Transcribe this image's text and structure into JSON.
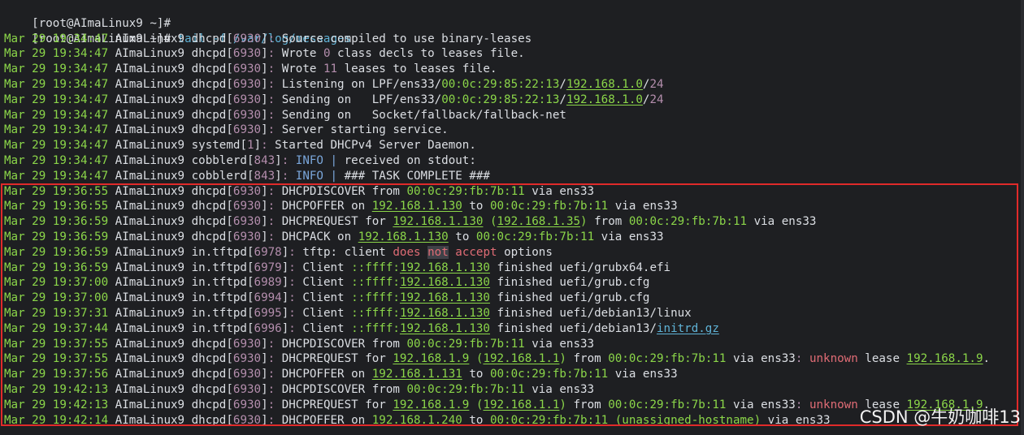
{
  "terminal": {
    "prompt1": "[root@AImaLinux9 ~]#",
    "prompt2": "[root@AImaLinux9 ~]#",
    "command": " tail -f /var/log/messages"
  },
  "log": [
    {
      "ts": "Mar 29 19:34:47",
      "host": "AImaLinux9",
      "proc": "dhcpd",
      "pid": "6930",
      "segs": [
        {
          "t": "Source compiled to use binary-leases",
          "c": "white"
        }
      ]
    },
    {
      "ts": "Mar 29 19:34:47",
      "host": "AImaLinux9",
      "proc": "dhcpd",
      "pid": "6930",
      "segs": [
        {
          "t": "Wrote ",
          "c": "white"
        },
        {
          "t": "0",
          "c": "violet"
        },
        {
          "t": " class decls to leases file.",
          "c": "white"
        }
      ]
    },
    {
      "ts": "Mar 29 19:34:47",
      "host": "AImaLinux9",
      "proc": "dhcpd",
      "pid": "6930",
      "segs": [
        {
          "t": "Wrote ",
          "c": "white"
        },
        {
          "t": "11",
          "c": "violet"
        },
        {
          "t": " leases to leases file.",
          "c": "white"
        }
      ]
    },
    {
      "ts": "Mar 29 19:34:47",
      "host": "AImaLinux9",
      "proc": "dhcpd",
      "pid": "6930",
      "segs": [
        {
          "t": "Listening on LPF/ens33/",
          "c": "white"
        },
        {
          "t": "00:0c:29:85:22:13",
          "c": "green"
        },
        {
          "t": "/",
          "c": "white"
        },
        {
          "t": "192.168.1.0",
          "c": "green",
          "u": true
        },
        {
          "t": "/",
          "c": "white"
        },
        {
          "t": "24",
          "c": "violet"
        }
      ]
    },
    {
      "ts": "Mar 29 19:34:47",
      "host": "AImaLinux9",
      "proc": "dhcpd",
      "pid": "6930",
      "segs": [
        {
          "t": "Sending on   LPF/ens33/",
          "c": "white"
        },
        {
          "t": "00:0c:29:85:22:13",
          "c": "green"
        },
        {
          "t": "/",
          "c": "white"
        },
        {
          "t": "192.168.1.0",
          "c": "green",
          "u": true
        },
        {
          "t": "/",
          "c": "white"
        },
        {
          "t": "24",
          "c": "violet"
        }
      ]
    },
    {
      "ts": "Mar 29 19:34:47",
      "host": "AImaLinux9",
      "proc": "dhcpd",
      "pid": "6930",
      "segs": [
        {
          "t": "Sending on   Socket/fallback/fallback-net",
          "c": "white"
        }
      ]
    },
    {
      "ts": "Mar 29 19:34:47",
      "host": "AImaLinux9",
      "proc": "dhcpd",
      "pid": "6930",
      "segs": [
        {
          "t": "Server starting service.",
          "c": "white"
        }
      ]
    },
    {
      "ts": "Mar 29 19:34:47",
      "host": "AImaLinux9",
      "proc": "systemd",
      "pid": "1",
      "segs": [
        {
          "t": "Started DHCPv4 Server Daemon.",
          "c": "white"
        }
      ]
    },
    {
      "ts": "Mar 29 19:34:47",
      "host": "AImaLinux9",
      "proc": "cobblerd",
      "pid": "843",
      "segs": [
        {
          "t": "INFO",
          "c": "blue"
        },
        {
          "t": " | ",
          "c": "blue"
        },
        {
          "t": "received on stdout:",
          "c": "white"
        }
      ]
    },
    {
      "ts": "Mar 29 19:34:47",
      "host": "AImaLinux9",
      "proc": "cobblerd",
      "pid": "843",
      "segs": [
        {
          "t": "INFO",
          "c": "blue"
        },
        {
          "t": " | ",
          "c": "blue"
        },
        {
          "t": "### TASK COMPLETE ###",
          "c": "white"
        }
      ]
    },
    {
      "ts": "Mar 29 19:36:55",
      "host": "AImaLinux9",
      "proc": "dhcpd",
      "pid": "6930",
      "segs": [
        {
          "t": "DHCPDISCOVER from ",
          "c": "white"
        },
        {
          "t": "00:0c:29:fb:7b:11",
          "c": "green"
        },
        {
          "t": " via ens33",
          "c": "white"
        }
      ]
    },
    {
      "ts": "Mar 29 19:36:55",
      "host": "AImaLinux9",
      "proc": "dhcpd",
      "pid": "6930",
      "segs": [
        {
          "t": "DHCPOFFER on ",
          "c": "white"
        },
        {
          "t": "192.168.1.130",
          "c": "green",
          "u": true
        },
        {
          "t": " to ",
          "c": "white"
        },
        {
          "t": "00:0c:29:fb:7b:11",
          "c": "green"
        },
        {
          "t": " via ens33",
          "c": "white"
        }
      ]
    },
    {
      "ts": "Mar 29 19:36:59",
      "host": "AImaLinux9",
      "proc": "dhcpd",
      "pid": "6930",
      "segs": [
        {
          "t": "DHCPREQUEST for ",
          "c": "white"
        },
        {
          "t": "192.168.1.130",
          "c": "green",
          "u": true
        },
        {
          "t": " (",
          "c": "green"
        },
        {
          "t": "192.168.1.35",
          "c": "green",
          "u": true
        },
        {
          "t": ")",
          "c": "green"
        },
        {
          "t": " from ",
          "c": "white"
        },
        {
          "t": "00:0c:29:fb:7b:11",
          "c": "green"
        },
        {
          "t": " via ens33",
          "c": "white"
        }
      ]
    },
    {
      "ts": "Mar 29 19:36:59",
      "host": "AImaLinux9",
      "proc": "dhcpd",
      "pid": "6930",
      "segs": [
        {
          "t": "DHCPACK on ",
          "c": "white"
        },
        {
          "t": "192.168.1.130",
          "c": "green",
          "u": true
        },
        {
          "t": " to ",
          "c": "white"
        },
        {
          "t": "00:0c:29:fb:7b:11",
          "c": "green"
        },
        {
          "t": " via ens33",
          "c": "white"
        }
      ]
    },
    {
      "ts": "Mar 29 19:36:59",
      "host": "AImaLinux9",
      "proc": "in.tftpd",
      "pid": "6978",
      "segs": [
        {
          "t": "tftp: client ",
          "c": "white"
        },
        {
          "t": "does",
          "c": "red"
        },
        {
          "t": " ",
          "c": "white"
        },
        {
          "t": "not",
          "c": "red",
          "hl": true
        },
        {
          "t": " ",
          "c": "white"
        },
        {
          "t": "accept",
          "c": "red"
        },
        {
          "t": " options",
          "c": "white"
        }
      ]
    },
    {
      "ts": "Mar 29 19:36:59",
      "host": "AImaLinux9",
      "proc": "in.tftpd",
      "pid": "6979",
      "segs": [
        {
          "t": "Client ",
          "c": "white"
        },
        {
          "t": "::ffff:",
          "c": "green"
        },
        {
          "t": "192.168.1.130",
          "c": "green",
          "u": true
        },
        {
          "t": " finished uefi/grubx64.efi",
          "c": "white"
        }
      ]
    },
    {
      "ts": "Mar 29 19:37:00",
      "host": "AImaLinux9",
      "proc": "in.tftpd",
      "pid": "6989",
      "segs": [
        {
          "t": "Client ",
          "c": "white"
        },
        {
          "t": "::ffff:",
          "c": "green"
        },
        {
          "t": "192.168.1.130",
          "c": "green",
          "u": true
        },
        {
          "t": " finished uefi/grub.cfg",
          "c": "white"
        }
      ]
    },
    {
      "ts": "Mar 29 19:37:00",
      "host": "AImaLinux9",
      "proc": "in.tftpd",
      "pid": "6994",
      "segs": [
        {
          "t": "Client ",
          "c": "white"
        },
        {
          "t": "::ffff:",
          "c": "green"
        },
        {
          "t": "192.168.1.130",
          "c": "green",
          "u": true
        },
        {
          "t": " finished uefi/grub.cfg",
          "c": "white"
        }
      ]
    },
    {
      "ts": "Mar 29 19:37:31",
      "host": "AImaLinux9",
      "proc": "in.tftpd",
      "pid": "6995",
      "segs": [
        {
          "t": "Client ",
          "c": "white"
        },
        {
          "t": "::ffff:",
          "c": "green"
        },
        {
          "t": "192.168.1.130",
          "c": "green",
          "u": true
        },
        {
          "t": " finished uefi/debian13/linux",
          "c": "white"
        }
      ]
    },
    {
      "ts": "Mar 29 19:37:44",
      "host": "AImaLinux9",
      "proc": "in.tftpd",
      "pid": "6996",
      "segs": [
        {
          "t": "Client ",
          "c": "white"
        },
        {
          "t": "::ffff:",
          "c": "green"
        },
        {
          "t": "192.168.1.130",
          "c": "green",
          "u": true
        },
        {
          "t": " finished uefi/debian13/",
          "c": "white"
        },
        {
          "t": "initrd.gz",
          "c": "cyan",
          "u": true
        }
      ]
    },
    {
      "ts": "Mar 29 19:37:55",
      "host": "AImaLinux9",
      "proc": "dhcpd",
      "pid": "6930",
      "segs": [
        {
          "t": "DHCPDISCOVER from ",
          "c": "white"
        },
        {
          "t": "00:0c:29:fb:7b:11",
          "c": "green"
        },
        {
          "t": " via ens33",
          "c": "white"
        }
      ]
    },
    {
      "ts": "Mar 29 19:37:55",
      "host": "AImaLinux9",
      "proc": "dhcpd",
      "pid": "6930",
      "segs": [
        {
          "t": "DHCPREQUEST for ",
          "c": "white"
        },
        {
          "t": "192.168.1.9",
          "c": "green",
          "u": true
        },
        {
          "t": " (",
          "c": "green"
        },
        {
          "t": "192.168.1.1",
          "c": "green",
          "u": true
        },
        {
          "t": ")",
          "c": "green"
        },
        {
          "t": " from ",
          "c": "white"
        },
        {
          "t": "00:0c:29:fb:7b:11",
          "c": "green"
        },
        {
          "t": " via ens33",
          "c": "white"
        },
        {
          "t": ": ",
          "c": "violet"
        },
        {
          "t": "unknown",
          "c": "red"
        },
        {
          "t": " lease ",
          "c": "white"
        },
        {
          "t": "192.168.1.9",
          "c": "green",
          "u": true
        },
        {
          "t": ".",
          "c": "white"
        }
      ]
    },
    {
      "ts": "Mar 29 19:37:56",
      "host": "AImaLinux9",
      "proc": "dhcpd",
      "pid": "6930",
      "segs": [
        {
          "t": "DHCPOFFER on ",
          "c": "white"
        },
        {
          "t": "192.168.1.131",
          "c": "green",
          "u": true
        },
        {
          "t": " to ",
          "c": "white"
        },
        {
          "t": "00:0c:29:fb:7b:11",
          "c": "green"
        },
        {
          "t": " via ens33",
          "c": "white"
        }
      ]
    },
    {
      "ts": "Mar 29 19:42:13",
      "host": "AImaLinux9",
      "proc": "dhcpd",
      "pid": "6930",
      "segs": [
        {
          "t": "DHCPDISCOVER from ",
          "c": "white"
        },
        {
          "t": "00:0c:29:fb:7b:11",
          "c": "green"
        },
        {
          "t": " via ens33",
          "c": "white"
        }
      ]
    },
    {
      "ts": "Mar 29 19:42:13",
      "host": "AImaLinux9",
      "proc": "dhcpd",
      "pid": "6930",
      "segs": [
        {
          "t": "DHCPREQUEST for ",
          "c": "white"
        },
        {
          "t": "192.168.1.9",
          "c": "green",
          "u": true
        },
        {
          "t": " (",
          "c": "green"
        },
        {
          "t": "192.168.1.1",
          "c": "green",
          "u": true
        },
        {
          "t": ")",
          "c": "green"
        },
        {
          "t": " from ",
          "c": "white"
        },
        {
          "t": "00:0c:29:fb:7b:11",
          "c": "green"
        },
        {
          "t": " via ens33",
          "c": "white"
        },
        {
          "t": ": ",
          "c": "violet"
        },
        {
          "t": "unknown",
          "c": "red"
        },
        {
          "t": " lease ",
          "c": "white"
        },
        {
          "t": "192.168.1.9",
          "c": "green",
          "u": true
        },
        {
          "t": ".",
          "c": "white"
        }
      ]
    },
    {
      "ts": "Mar 29 19:42:14",
      "host": "AImaLinux9",
      "proc": "dhcpd",
      "pid": "6930",
      "segs": [
        {
          "t": "DHCPOFFER on ",
          "c": "white"
        },
        {
          "t": "192.168.1.240",
          "c": "green",
          "u": true
        },
        {
          "t": " to ",
          "c": "white"
        },
        {
          "t": "00:0c:29:fb:7b:11",
          "c": "green"
        },
        {
          "t": " (unassigned-hostname)",
          "c": "green"
        },
        {
          "t": " via ens33",
          "c": "white"
        }
      ]
    }
  ],
  "watermark": "CSDN @牛奶咖啡13",
  "colors": {
    "background": "#1e1f22",
    "text": "#dcdfe4",
    "timestamp": "#8bd649",
    "number": "#b48ead",
    "info": "#7aa6da",
    "error": "#e06c75",
    "link": "#5fb3d7",
    "highlight_border": "#e02a2a"
  }
}
